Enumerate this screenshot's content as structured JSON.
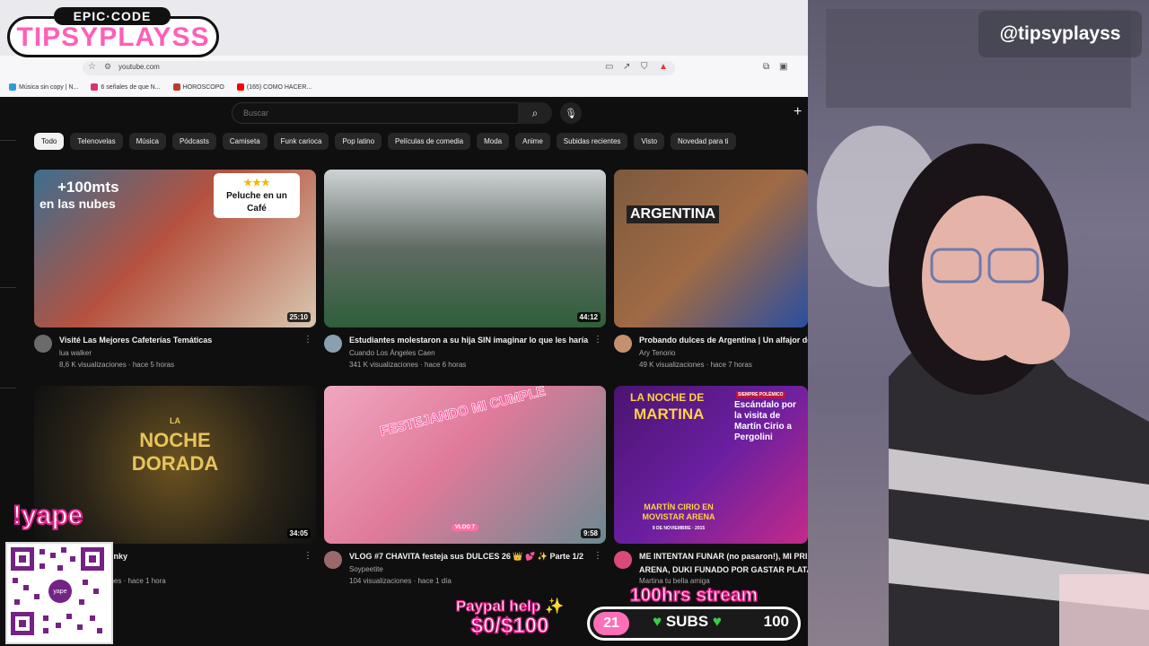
{
  "browser": {
    "url": "youtube.com",
    "bookmarks": [
      {
        "label": "Música sin copy | N...",
        "color": "#2d9cdb"
      },
      {
        "label": "6 señales de que N...",
        "color": "#d6336c"
      },
      {
        "label": "HOROSCOPO",
        "color": "#c0392b"
      },
      {
        "label": "(165) COMO HACER...",
        "color": "#ff0000"
      }
    ]
  },
  "youtube": {
    "search_placeholder": "Buscar",
    "chips": [
      "Todo",
      "Telenovelas",
      "Música",
      "Pódcasts",
      "Camiseta",
      "Funk carioca",
      "Pop latino",
      "Películas de comedia",
      "Moda",
      "Anime",
      "Subidas recientes",
      "Visto",
      "Novedad para ti"
    ],
    "videos": [
      {
        "title": "Visité Las Mejores Cafeterías Temáticas",
        "channel": "lua walker",
        "meta": "8,6 K visualizaciones · hace 5 horas",
        "duration": "25:10",
        "overlay1": "+100mts",
        "overlay2": "en las nubes",
        "overlay3": "Peluche en un",
        "overlay4": "Café",
        "thumb_bg": "#b5523f",
        "avatar_color": "#6b6b6b"
      },
      {
        "title": "Estudiantes molestaron a su hija SIN imaginar lo que les haría",
        "channel": "Cuando Los Ángeles Caen",
        "meta": "341 K visualizaciones · hace 6 horas",
        "duration": "44:12",
        "thumb_bg": "#5f6b63",
        "avatar_color": "#8aa0b0"
      },
      {
        "title": "Probando dulces de Argentina | Un alfajor de",
        "channel": "Ary Tenorio",
        "meta": "49 K visualizaciones · hace 7 horas",
        "overlay1": "ARGENTINA",
        "thumb_bg": "#a06a45",
        "avatar_color": "#c49070"
      },
      {
        "title": "Pinky",
        "channel": "",
        "meta": "ones · hace 1 hora",
        "duration": "34:05",
        "overlay1": "LA",
        "overlay2": "NOCHE",
        "overlay3": "DORADA",
        "thumb_bg": "#2a2418",
        "avatar_color": "#555555"
      },
      {
        "title": "VLOG #7 CHAVITA festeja sus DULCES 26 👑 💕 ✨ Parte 1/2",
        "channel": "Soypeetite",
        "meta": "104 visualizaciones · hace 1 día",
        "duration": "9:58",
        "overlay1": "FESTEJANDO MI CUMPLE",
        "overlay2": "VLOG 7",
        "thumb_bg": "#e07a9a",
        "avatar_color": "#9a6a6a"
      },
      {
        "title": "ME INTENTAN FUNAR (no pasaron!), MI PRI",
        "title2": "ARENA, DUKI FUNADO POR GASTAR PLATA",
        "channel": "Martina tu bella amiga",
        "meta": "",
        "overlay1": "LA NOCHE DE",
        "overlay2": "MARTINA",
        "overlay3": "SIEMPRE POLÉMICO",
        "overlay4": "Escándalo por la visita de Martín Cirio a Pergolini",
        "overlay5": "MARTÍN CIRIO EN MOVISTAR ARENA",
        "overlay6": "9 DE NOVIEMBRE · 2015",
        "thumb_bg": "#6a1fa0",
        "avatar_color": "#d94a7a"
      }
    ]
  },
  "overlays": {
    "logo_top": "EPIC·CODE",
    "logo_main": "TIPSYPLAYSS",
    "handle": "@tipsyplayss",
    "yape_label": "!yape",
    "yape_qr_label": "yape",
    "paypal_line1": "Paypal help ✨",
    "paypal_line2": "$0/$100",
    "stream_title": "100hrs stream",
    "stream_count": "21",
    "stream_subs": "SUBS",
    "stream_heart": "♥",
    "stream_goal": "100"
  }
}
